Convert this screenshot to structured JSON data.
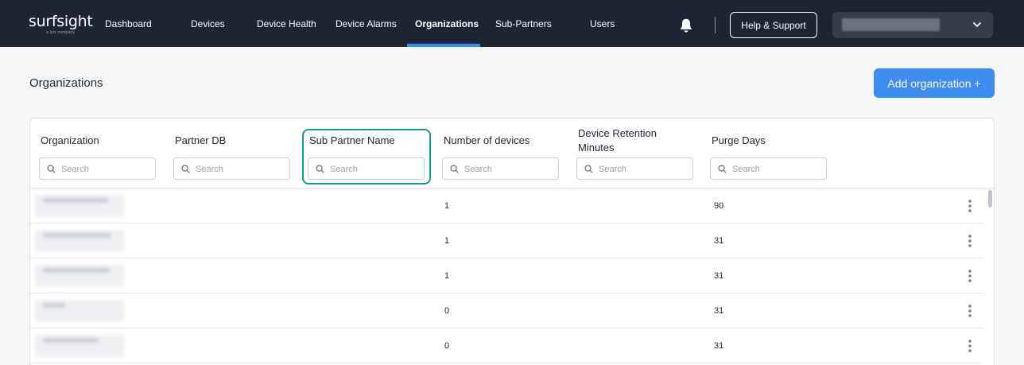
{
  "app": {
    "logo": "surfsight",
    "logo_sub": "a lytx company"
  },
  "nav": {
    "items": [
      {
        "label": "Dashboard"
      },
      {
        "label": "Devices"
      },
      {
        "label": "Device Health"
      },
      {
        "label": "Device Alarms"
      },
      {
        "label": "Organizations",
        "active": true
      },
      {
        "label": "Sub-Partners"
      },
      {
        "label": "Users"
      }
    ],
    "help_label": "Help & Support",
    "bell_icon": "bell-icon",
    "account_chevron_icon": "chevron-down-icon"
  },
  "page": {
    "title": "Organizations",
    "add_button_label": "Add organization +"
  },
  "table": {
    "columns": [
      {
        "label": "Organization",
        "search_placeholder": "Search"
      },
      {
        "label": "Partner DB",
        "search_placeholder": "Search"
      },
      {
        "label": "Sub Partner Name",
        "search_placeholder": "Search"
      },
      {
        "label": "Number of devices",
        "search_placeholder": "Search"
      },
      {
        "label": "Device Retention Minutes",
        "search_placeholder": "Search"
      },
      {
        "label": "Purge Days",
        "search_placeholder": "Search"
      }
    ],
    "rows": [
      {
        "devices": "1",
        "purge_days": "90"
      },
      {
        "devices": "1",
        "purge_days": "31"
      },
      {
        "devices": "1",
        "purge_days": "31"
      },
      {
        "devices": "0",
        "purge_days": "31"
      },
      {
        "devices": "0",
        "purge_days": "31"
      }
    ],
    "row_menu_icon": "kebab-menu-icon",
    "search_icon": "search-icon"
  },
  "colors": {
    "nav_bg": "#1d2535",
    "accent": "#3d8df0",
    "highlight": "#159c88"
  }
}
